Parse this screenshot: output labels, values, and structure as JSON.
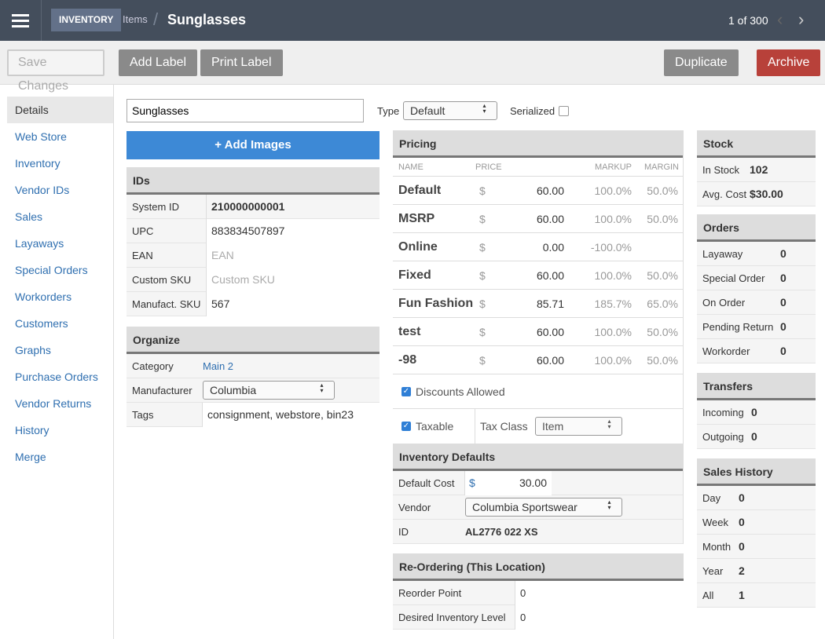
{
  "header": {
    "section": "INVENTORY",
    "crumb": "Items",
    "separator": "/",
    "title": "Sunglasses",
    "pager": "1 of 300"
  },
  "toolbar": {
    "save": "Save Changes",
    "add_label": "Add Label",
    "print_label": "Print Label",
    "duplicate": "Duplicate",
    "archive": "Archive"
  },
  "sidebar": {
    "items": [
      "Details",
      "Web Store",
      "Inventory",
      "Vendor IDs",
      "Sales",
      "Layaways",
      "Special Orders",
      "Workorders",
      "Customers",
      "Graphs",
      "Purchase Orders",
      "Vendor Returns",
      "History",
      "Merge"
    ]
  },
  "item": {
    "name": "Sunglasses",
    "type_label": "Type",
    "type": "Default",
    "serialized_label": "Serialized",
    "add_images": "+ Add Images"
  },
  "ids": {
    "title": "IDs",
    "rows": [
      {
        "k": "System ID",
        "v": "210000000001",
        "bold": true
      },
      {
        "k": "UPC",
        "v": "883834507897"
      },
      {
        "k": "EAN",
        "v": "",
        "ph": "EAN"
      },
      {
        "k": "Custom SKU",
        "v": "",
        "ph": "Custom SKU"
      },
      {
        "k": "Manufact. SKU",
        "v": "567"
      }
    ]
  },
  "organize": {
    "title": "Organize",
    "category_label": "Category",
    "category": "Main 2",
    "manufacturer_label": "Manufacturer",
    "manufacturer": "Columbia",
    "tags_label": "Tags",
    "tags": "consignment, webstore, bin23"
  },
  "pricing": {
    "title": "Pricing",
    "cols": [
      "NAME",
      "PRICE",
      "MARKUP",
      "MARGIN"
    ],
    "rows": [
      {
        "name": "Default",
        "cur": "$",
        "price": "60.00",
        "markup": "100.0%",
        "margin": "50.0%"
      },
      {
        "name": "MSRP",
        "cur": "$",
        "price": "60.00",
        "markup": "100.0%",
        "margin": "50.0%"
      },
      {
        "name": "Online",
        "cur": "$",
        "price": "0.00",
        "markup": "-100.0%",
        "margin": ""
      },
      {
        "name": "Fixed",
        "cur": "$",
        "price": "60.00",
        "markup": "100.0%",
        "margin": "50.0%"
      },
      {
        "name": "Fun Fashion",
        "cur": "$",
        "price": "85.71",
        "markup": "185.7%",
        "margin": "65.0%"
      },
      {
        "name": "test",
        "cur": "$",
        "price": "60.00",
        "markup": "100.0%",
        "margin": "50.0%"
      },
      {
        "name": "-98",
        "cur": "$",
        "price": "60.00",
        "markup": "100.0%",
        "margin": "50.0%"
      }
    ],
    "discounts": "Discounts Allowed",
    "taxable": "Taxable",
    "tax_class_label": "Tax Class",
    "tax_class": "Item"
  },
  "inv_defaults": {
    "title": "Inventory Defaults",
    "cost_label": "Default Cost",
    "cur": "$",
    "cost": "30.00",
    "vendor_label": "Vendor",
    "vendor": "Columbia Sportswear",
    "id_label": "ID",
    "id": "AL2776 022 XS"
  },
  "reorder": {
    "title": "Re-Ordering (This Location)",
    "point_label": "Reorder Point",
    "point": "0",
    "desired_label": "Desired Inventory Level",
    "desired": "0"
  },
  "stock": {
    "title": "Stock",
    "rows": [
      {
        "k": "In Stock",
        "v": "102"
      },
      {
        "k": "Avg. Cost",
        "v": "$30.00"
      }
    ]
  },
  "orders": {
    "title": "Orders",
    "rows": [
      {
        "k": "Layaway",
        "v": "0"
      },
      {
        "k": "Special Order",
        "v": "0"
      },
      {
        "k": "On Order",
        "v": "0"
      },
      {
        "k": "Pending Return",
        "v": "0"
      },
      {
        "k": "Workorder",
        "v": "0"
      }
    ]
  },
  "transfers": {
    "title": "Transfers",
    "rows": [
      {
        "k": "Incoming",
        "v": "0"
      },
      {
        "k": "Outgoing",
        "v": "0"
      }
    ]
  },
  "sales_history": {
    "title": "Sales History",
    "rows": [
      {
        "k": "Day",
        "v": "0"
      },
      {
        "k": "Week",
        "v": "0"
      },
      {
        "k": "Month",
        "v": "0"
      },
      {
        "k": "Year",
        "v": "2"
      },
      {
        "k": "All",
        "v": "1"
      }
    ]
  }
}
